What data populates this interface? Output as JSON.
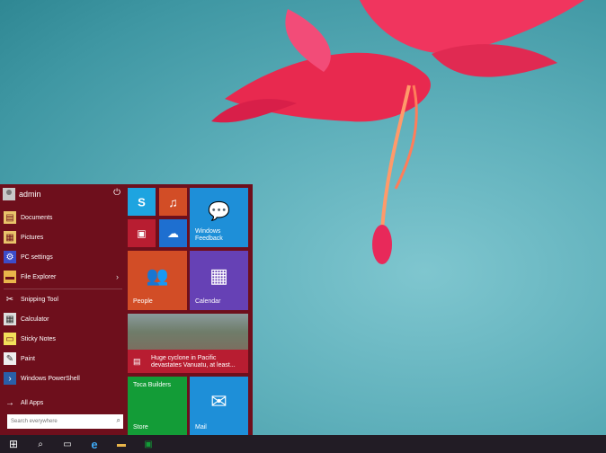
{
  "start_menu": {
    "user": "admin",
    "items": [
      {
        "label": "Documents",
        "icon": "documents-icon"
      },
      {
        "label": "Pictures",
        "icon": "pictures-icon"
      },
      {
        "label": "PC settings",
        "icon": "gear-icon"
      },
      {
        "label": "File Explorer",
        "icon": "folder-icon"
      },
      {
        "label": "Snipping Tool",
        "icon": "scissors-icon"
      },
      {
        "label": "Calculator",
        "icon": "calculator-icon"
      },
      {
        "label": "Sticky Notes",
        "icon": "note-icon"
      },
      {
        "label": "Paint",
        "icon": "paint-icon"
      },
      {
        "label": "Windows PowerShell",
        "icon": "powershell-icon"
      }
    ],
    "all_apps": "All Apps",
    "search_placeholder": "Search everywhere"
  },
  "tiles": {
    "windows_feedback": "Windows Feedback",
    "people": "People",
    "calendar": "Calendar",
    "news": "Huge cyclone in Pacific devastates Vanuatu, at least...",
    "toca": "Toca Builders",
    "store": "Store",
    "mail": "Mail"
  },
  "colors": {
    "menu_bg": "#6e0f1c",
    "tile_blue": "#1e8fd8",
    "tile_orange": "#d24d26",
    "tile_purple": "#6641b5",
    "tile_green": "#139c37",
    "tile_red": "#b81d31",
    "taskbar": "#221c25"
  }
}
